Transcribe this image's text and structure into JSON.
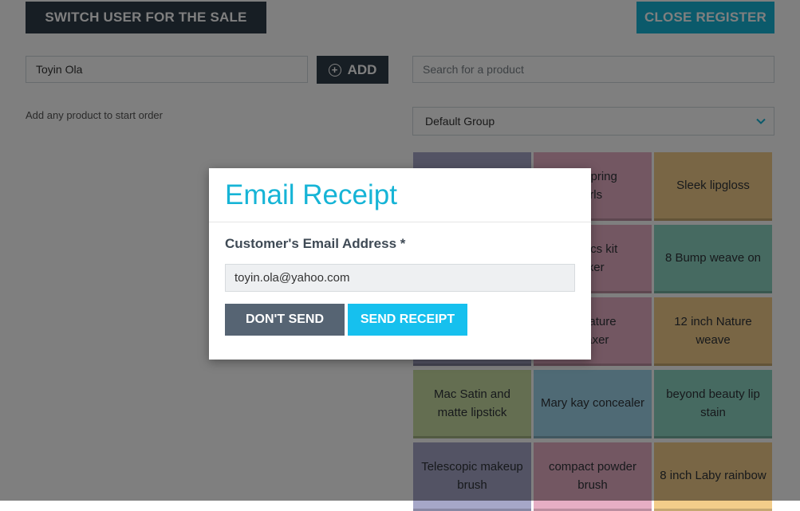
{
  "header": {
    "switch_user_label": "SWITCH USER FOR THE SALE",
    "close_register_label": "CLOSE REGISTER"
  },
  "order": {
    "customer_value": "Toyin Ola",
    "add_label": "ADD",
    "hint": "Add any product to start order"
  },
  "catalog": {
    "search_placeholder": "Search for a product",
    "group_selected": "Default Group",
    "products": [
      {
        "label": "",
        "color": "#a6a7c8"
      },
      {
        "label": "air spring\nurls",
        "color": "#e6aec4"
      },
      {
        "label": "Sleek lipgloss",
        "color": "#f3cd8a"
      },
      {
        "label": "",
        "color": "#a6a7c8"
      },
      {
        "label": "ganics kit\naxer",
        "color": "#e6aec4"
      },
      {
        "label": "8 Bump weave on",
        "color": "#8dd5c3"
      },
      {
        "label": "",
        "color": "#a6a7c8"
      },
      {
        "label": "of nature\nelaxer",
        "color": "#e6aec4"
      },
      {
        "label": "12 inch Nature weave",
        "color": "#f3cd8a"
      },
      {
        "label": "Mac Satin and matte lipstick",
        "color": "#c8dca3"
      },
      {
        "label": "Mary kay concealer",
        "color": "#9fd5ea"
      },
      {
        "label": "beyond beauty lip stain",
        "color": "#8dd5c3"
      },
      {
        "label": "Telescopic makeup brush",
        "color": "#a6a7c8"
      },
      {
        "label": "compact powder brush",
        "color": "#e6aec4"
      },
      {
        "label": "8 inch Laby rainbow",
        "color": "#f3cd8a"
      }
    ]
  },
  "modal": {
    "title": "Email Receipt",
    "email_label": "Customer's Email Address *",
    "email_value": "toyin.ola@yahoo.com",
    "dont_send_label": "DON'T SEND",
    "send_label": "SEND RECEIPT"
  },
  "colors": {
    "dark_button": "#2f3c48",
    "accent": "#16b4d6",
    "overlay": "rgba(0,0,0,0.5)"
  }
}
